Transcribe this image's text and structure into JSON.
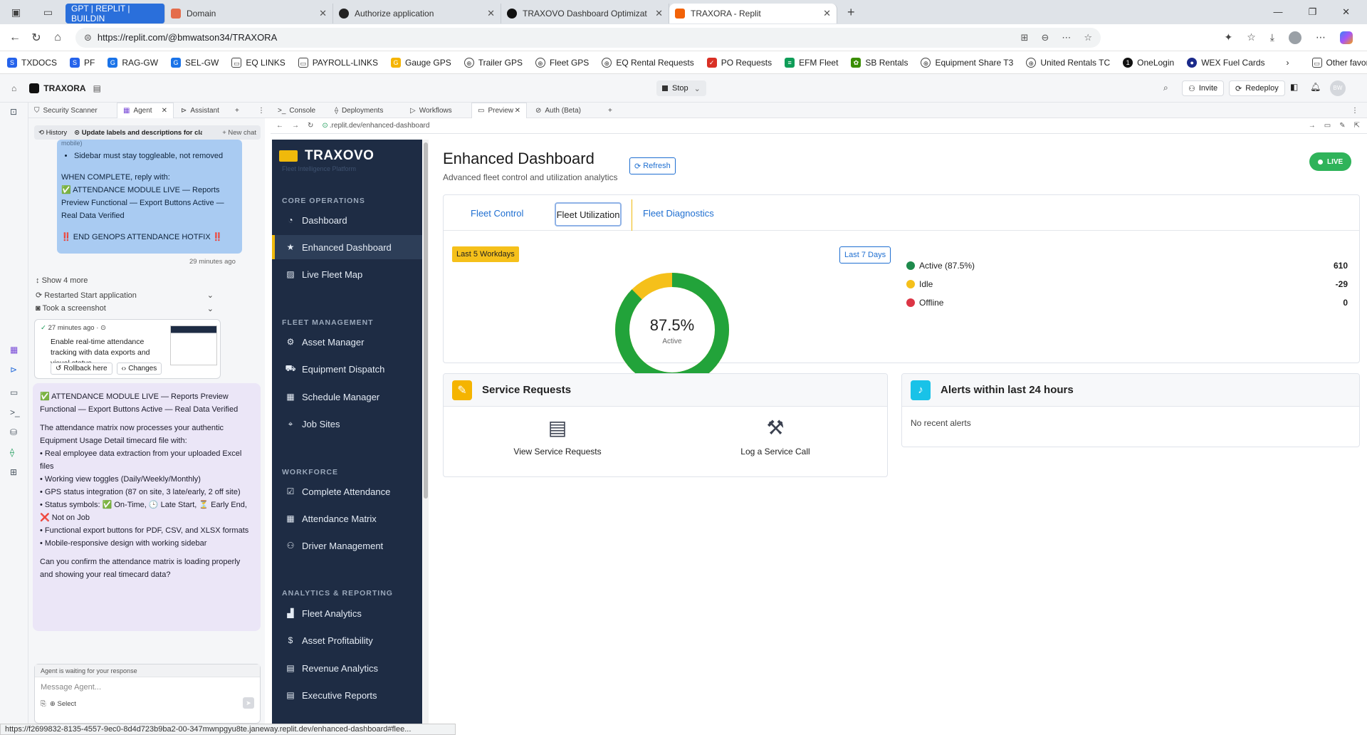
{
  "browser": {
    "tabs": [
      {
        "label": "GPT | REPLIT | BUILDIN",
        "active": false
      },
      {
        "label": "Domain",
        "active": false
      },
      {
        "label": "Authorize application",
        "active": false
      },
      {
        "label": "TRAXOVO Dashboard Optimizatio",
        "active": false
      },
      {
        "label": "TRAXORA - Replit",
        "active": true
      }
    ],
    "url": "https://replit.com/@bmwatson34/TRAXORA",
    "bookmarks": [
      "TXDOCS",
      "PF",
      "RAG-GW",
      "SEL-GW",
      "EQ LINKS",
      "PAYROLL-LINKS",
      "Gauge GPS",
      "Trailer GPS",
      "Fleet GPS",
      "EQ Rental Requests",
      "PO Requests",
      "EFM Fleet",
      "SB Rentals",
      "Equipment Share T3",
      "United Rentals TC",
      "OneLogin",
      "WEX Fuel Cards"
    ],
    "other_favorites": "Other favorites",
    "status_url": "https://f2699832-8135-4557-9ec0-8d4d723b9ba2-00-347mwnpgyu8te.janeway.replit.dev/enhanced-dashboard#flee..."
  },
  "replit": {
    "project": "TRAXORA",
    "stop": "Stop",
    "invite": "Invite",
    "redeploy": "Redeploy",
    "avatar": "BW",
    "left_tabs": [
      "Security Scanner",
      "Agent",
      "Assistant"
    ],
    "right_tabs": [
      "Console",
      "Deployments",
      "Workflows",
      "Preview",
      "Auth (Beta)"
    ],
    "preview_url": ".replit.dev/enhanced-dashboard"
  },
  "agent": {
    "history": "History",
    "chat_title": "Update labels and descriptions for cla...",
    "new_chat": "+ New chat",
    "cut_text": "mobile)",
    "bullet": "Sidebar must stay toggleable, not removed",
    "when_complete": "WHEN COMPLETE, reply with:",
    "complete_msg": "✅ ATTENDANCE MODULE LIVE — Reports Preview Functional — Export Buttons Active — Real Data Verified",
    "end_msg": "‼️ END GENOPS ATTENDANCE HOTFIX ‼️",
    "msg_time": "29 minutes ago",
    "show_more": "Show 4 more",
    "restarted": "Restarted Start application",
    "screenshot": "Took a screenshot",
    "checkpoint_time": "27 minutes ago",
    "checkpoint_text": "Enable real-time attendance tracking with data exports and visual status",
    "rollback": "Rollback here",
    "changes": "Changes",
    "reply_head": "✅ ATTENDANCE MODULE LIVE — Reports Preview Functional — Export Buttons Active — Real Data Verified",
    "reply_intro": "The attendance matrix now processes your authentic Equipment Usage Detail timecard file with:",
    "reply_bullets": [
      "• Real employee data extraction from your uploaded Excel files",
      "• Working view toggles (Daily/Weekly/Monthly)",
      "• GPS status integration (87 on site, 3 late/early, 2 off site)",
      "• Status symbols: ✅ On-Time, 🕒 Late Start, ⏳ Early End, ❌ Not on Job",
      "• Functional export buttons for PDF, CSV, and XLSX formats",
      "• Mobile-responsive design with working sidebar"
    ],
    "reply_question": "Can you confirm the attendance matrix is loading properly and showing your real timecard data?",
    "waiting": "Agent is waiting for your response",
    "input_placeholder": "Message Agent...",
    "select": "Select"
  },
  "app": {
    "brand": "TRAXOVO",
    "tagline": "Fleet Intelligence Platform",
    "sections": [
      {
        "title": "CORE OPERATIONS",
        "items": [
          {
            "label": "Dashboard",
            "icon": "speedometer-icon"
          },
          {
            "label": "Enhanced Dashboard",
            "icon": "star-icon",
            "active": true
          },
          {
            "label": "Live Fleet Map",
            "icon": "map-icon"
          }
        ]
      },
      {
        "title": "FLEET MANAGEMENT",
        "items": [
          {
            "label": "Asset Manager",
            "icon": "cogs-icon"
          },
          {
            "label": "Equipment Dispatch",
            "icon": "truck-icon"
          },
          {
            "label": "Schedule Manager",
            "icon": "calendar-icon"
          },
          {
            "label": "Job Sites",
            "icon": "pin-icon"
          }
        ]
      },
      {
        "title": "WORKFORCE",
        "items": [
          {
            "label": "Complete Attendance",
            "icon": "user-check-icon"
          },
          {
            "label": "Attendance Matrix",
            "icon": "calendar-check-icon"
          },
          {
            "label": "Driver Management",
            "icon": "users-icon"
          }
        ]
      },
      {
        "title": "ANALYTICS & REPORTING",
        "items": [
          {
            "label": "Fleet Analytics",
            "icon": "chart-icon"
          },
          {
            "label": "Asset Profitability",
            "icon": "dollar-icon"
          },
          {
            "label": "Revenue Analytics",
            "icon": "file-icon"
          },
          {
            "label": "Executive Reports",
            "icon": "report-icon"
          }
        ]
      }
    ],
    "title": "Enhanced Dashboard",
    "subtitle": "Advanced fleet control and utilization analytics",
    "refresh": "Refresh",
    "live": "LIVE",
    "tabs": [
      "Fleet Control",
      "Fleet Utilization",
      "Fleet Diagnostics"
    ],
    "range_badge": "Last 5 Workdays",
    "range_button": "Last 7 Days",
    "donut": {
      "percent": "87.5%",
      "label": "Active",
      "active_fraction": 0.875,
      "colors": {
        "active": "#22a33a",
        "idle": "#f5c01a",
        "offline": "#dc3545"
      }
    },
    "legend": [
      {
        "label": "Active (87.5%)",
        "value": "610",
        "color": "#1e8a4c"
      },
      {
        "label": "Idle",
        "value": "-29",
        "color": "#f5c01a"
      },
      {
        "label": "Offline",
        "value": "0",
        "color": "#dc3545"
      }
    ],
    "service": {
      "title": "Service Requests",
      "view": "View Service Requests",
      "log": "Log a Service Call"
    },
    "alerts": {
      "title": "Alerts within last 24 hours",
      "empty": "No recent alerts"
    }
  },
  "colors": {
    "sidebar": "#1e2c44",
    "accent": "#f0b90b",
    "link": "#1f6fd1",
    "live": "#2fb35a"
  }
}
